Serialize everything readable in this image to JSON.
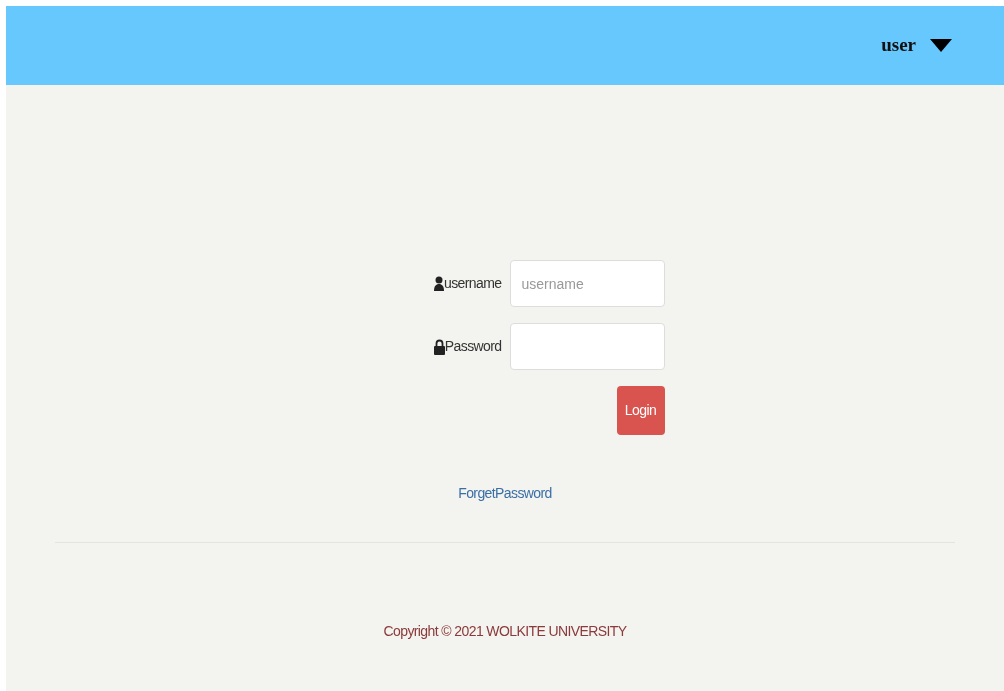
{
  "header": {
    "user_menu": "user"
  },
  "login_form": {
    "username": {
      "label": "username",
      "placeholder": "username"
    },
    "password": {
      "label": "Password"
    },
    "login_button": "Login",
    "forgot_link": "ForgetPassword"
  },
  "footer": {
    "copyright": "Copyright © 2021 WOLKITE UNIVERSITY"
  }
}
